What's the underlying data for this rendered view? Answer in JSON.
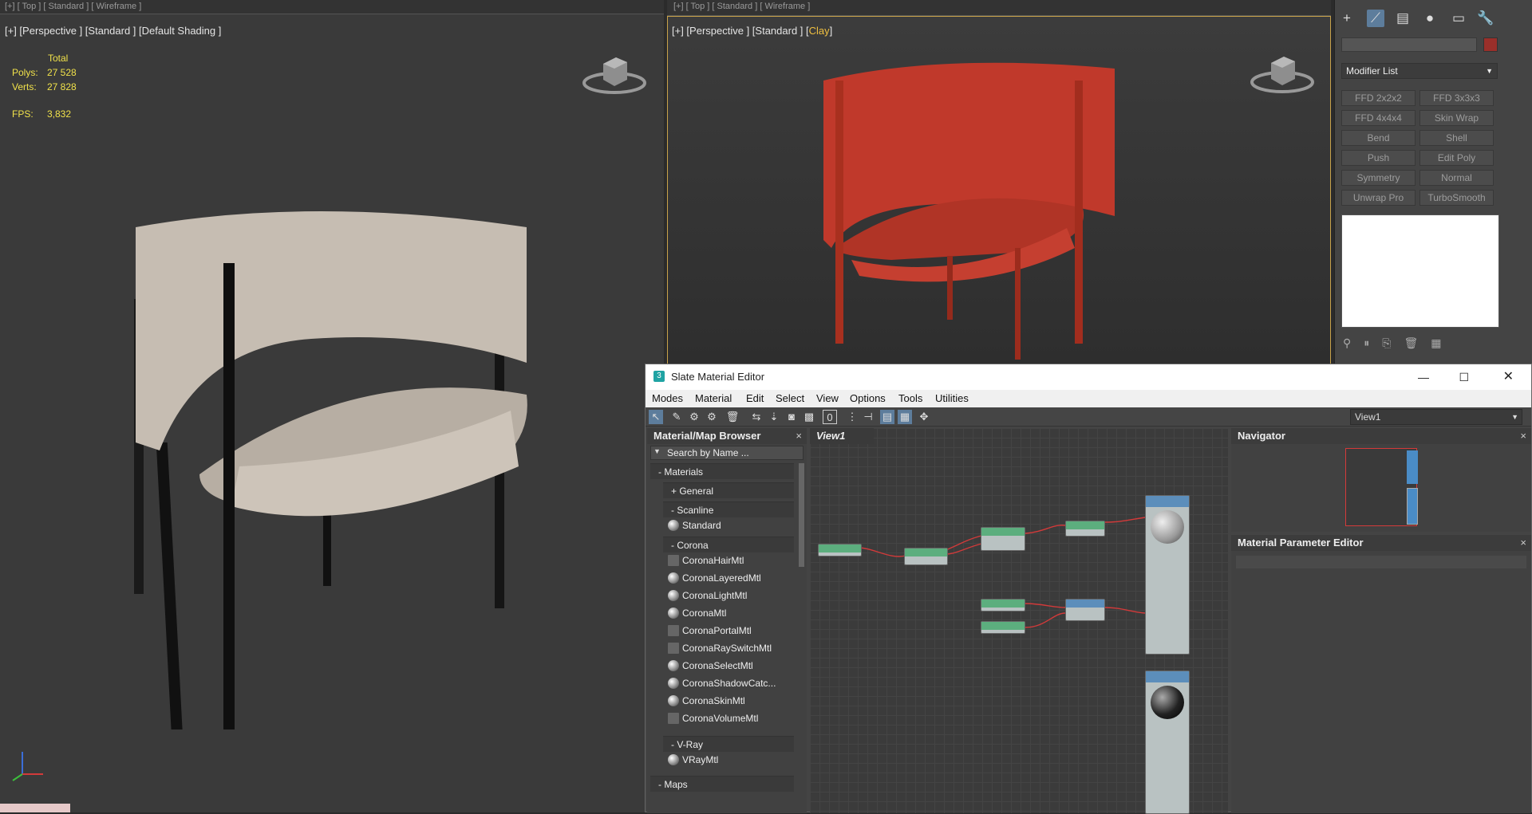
{
  "viewport_left": {
    "top_strip": "[+] [ Top ] [ Standard ] [ Wireframe ]",
    "label": "[+] [Perspective ] [Standard ] [Default Shading ]",
    "stats": {
      "total_label": "Total",
      "polys_label": "Polys:",
      "polys_value": "27 528",
      "verts_label": "Verts:",
      "verts_value": "27 828",
      "fps_label": "FPS:",
      "fps_value": "3,832"
    },
    "chair_color": "#c4bbb0"
  },
  "viewport_right": {
    "top_strip": "[+] [ Top ] [ Standard ] [ Wireframe ]",
    "label_prefix": "[+] [Perspective ] [Standard ] [",
    "label_shading": "Clay",
    "label_suffix": "]",
    "chair_color": "#b93a2c",
    "border_color": "#c8a24a"
  },
  "command_panel": {
    "tabs": [
      "plus-icon",
      "modify-icon",
      "hierarchy-icon",
      "motion-icon",
      "display-icon",
      "utilities-icon"
    ],
    "object_color": "#9a2f2a",
    "modifier_list_label": "Modifier List",
    "modifiers": [
      [
        "FFD 2x2x2",
        "FFD 3x3x3"
      ],
      [
        "FFD 4x4x4",
        "Skin Wrap"
      ],
      [
        "Bend",
        "Shell"
      ],
      [
        "Push",
        "Edit Poly"
      ],
      [
        "Symmetry",
        "Normal"
      ],
      [
        "Unwrap Pro",
        "TurboSmooth"
      ]
    ]
  },
  "slate": {
    "title": "Slate Material Editor",
    "menu": [
      "Modes",
      "Material",
      "Edit",
      "Select",
      "View",
      "Options",
      "Tools",
      "Utilities"
    ],
    "view_select": "View1",
    "browser": {
      "title": "Material/Map Browser",
      "search_placeholder": "Search by Name ...",
      "materials_label": "- Materials",
      "general_label": "+ General",
      "scanline_label": "- Scanline",
      "standard_label": "Standard",
      "corona_label": "- Corona",
      "corona_items": [
        "CoronaHairMtl",
        "CoronaLayeredMtl",
        "CoronaLightMtl",
        "CoronaMtl",
        "CoronaPortalMtl",
        "CoronaRaySwitchMtl",
        "CoronaSelectMtl",
        "CoronaShadowCatc...",
        "CoronaSkinMtl",
        "CoronaVolumeMtl"
      ],
      "vray_label": "- V-Ray",
      "vray_items": [
        "VRayMtl"
      ],
      "maps_label": "- Maps"
    },
    "view_tab": "View1",
    "navigator_title": "Navigator",
    "param_editor_title": "Material Parameter Editor"
  }
}
